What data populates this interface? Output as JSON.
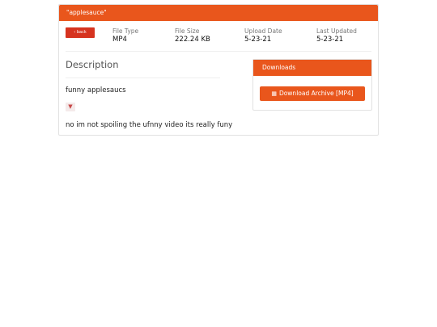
{
  "panel": {
    "title": "\"applesauce\""
  },
  "back_button": {
    "label": "‹ back"
  },
  "meta": [
    {
      "label": "File Type",
      "value": "MP4"
    },
    {
      "label": "File Size",
      "value": "222.24 KB"
    },
    {
      "label": "Upload Date",
      "value": "5-23-21"
    },
    {
      "label": "Last Updated",
      "value": "5-23-21"
    }
  ],
  "description": {
    "heading": "Description",
    "text": "funny applesaucs",
    "toggle_icon": "chevron-down-icon",
    "note": "no im not spoiling the ufnny video its really funy"
  },
  "downloads": {
    "heading": "Downloads",
    "button_label": "Download Archive [MP4]",
    "button_icon": "file-icon"
  },
  "colors": {
    "accent": "#e9561c",
    "back_button": "#d6331f"
  }
}
